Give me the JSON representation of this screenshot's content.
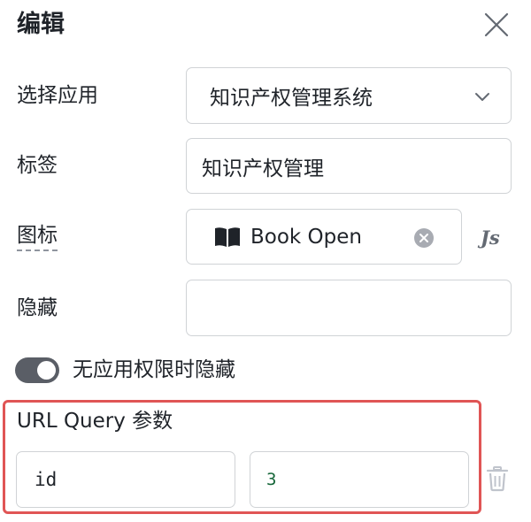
{
  "dialog": {
    "title": "编辑"
  },
  "form": {
    "app": {
      "label": "选择应用",
      "value": "知识产权管理系统"
    },
    "tag": {
      "label": "标签",
      "value": "知识产权管理"
    },
    "icon": {
      "label": "图标",
      "value": "Book Open",
      "icon_name": "book-open-icon",
      "js_label": "Js"
    },
    "hidden": {
      "label": "隐藏",
      "value": ""
    },
    "hide_without_permission": {
      "label": "无应用权限时隐藏",
      "enabled": true
    },
    "url_query": {
      "label": "URL Query 参数",
      "params": [
        {
          "key": "id",
          "value": "3"
        }
      ]
    }
  },
  "colors": {
    "highlight_border": "#e05555",
    "toggle_on": "#5a5e66",
    "query_value_text": "#17673a"
  }
}
